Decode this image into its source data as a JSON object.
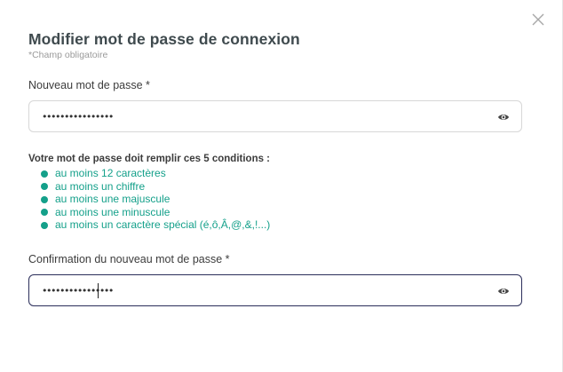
{
  "modal": {
    "title": "Modifier mot de passe de connexion",
    "required_note": "*Champ obligatoire",
    "close_icon": "close-icon"
  },
  "new_password": {
    "label": "Nouveau mot de passe *",
    "value": "••••••••••••••••",
    "eye_icon": "eye-icon"
  },
  "conditions": {
    "title": "Votre mot de passe doit remplir ces 5 conditions :",
    "items": [
      {
        "label": "au moins 12 caractères"
      },
      {
        "label": "au moins un chiffre"
      },
      {
        "label": "au moins une majuscule"
      },
      {
        "label": "au moins une minuscule"
      },
      {
        "label": "au moins un caractère spécial (é,ô,Â,@,&,!...)"
      }
    ],
    "met_color": "#14a08a"
  },
  "confirm_password": {
    "label": "Confirmation du nouveau mot de passe *",
    "value": "••••••••••••••••",
    "eye_icon": "eye-icon"
  },
  "colors": {
    "title": "#3f4a4e",
    "focus_border": "#2b2e5a",
    "accent": "#14a08a"
  }
}
